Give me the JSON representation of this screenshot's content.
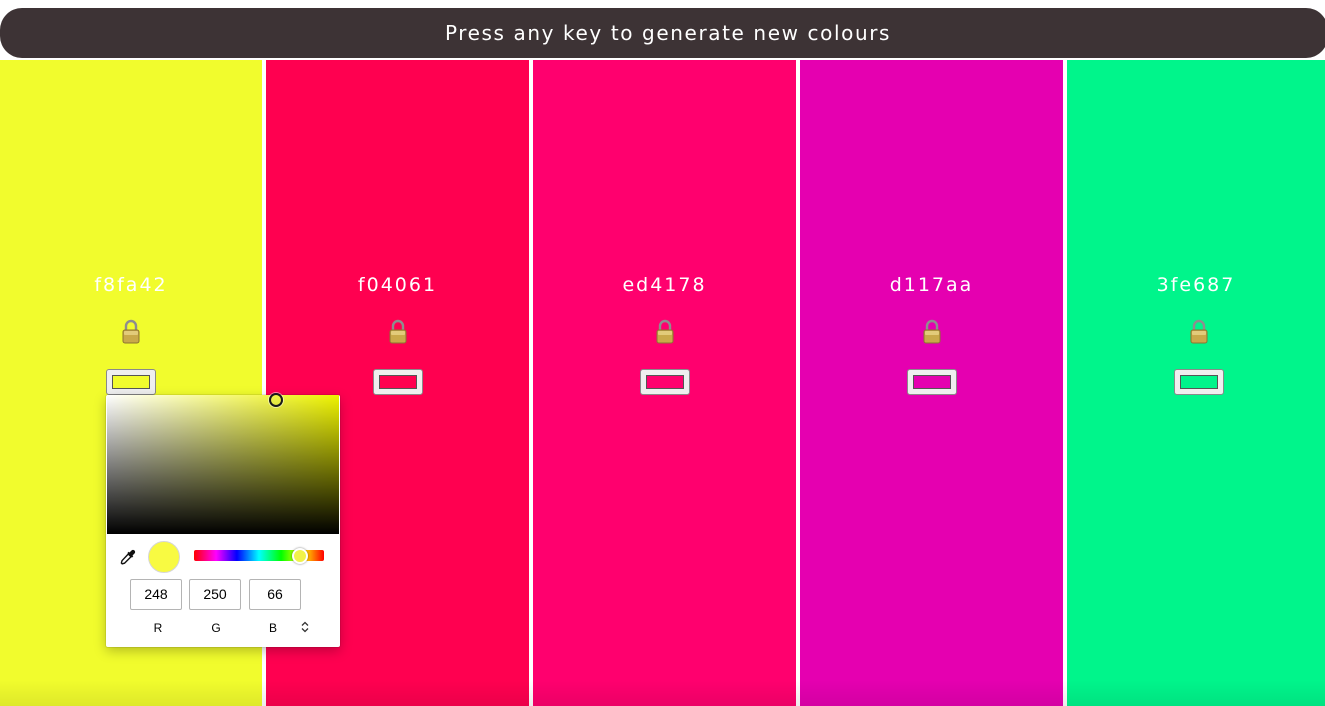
{
  "header": {
    "text": "Press any key to generate new colours",
    "background": "#3d3335"
  },
  "swatches": [
    {
      "hex": "f8fa42",
      "color": "#f1fc2d"
    },
    {
      "hex": "f04061",
      "color": "#ff0050"
    },
    {
      "hex": "ed4178",
      "color": "#ff006e"
    },
    {
      "hex": "d117aa",
      "color": "#e500b0"
    },
    {
      "hex": "3fe687",
      "color": "#00f58b"
    }
  ],
  "picker": {
    "selected_color": "#f8fa42",
    "r": "248",
    "g": "250",
    "b": "66",
    "labels": {
      "r": "R",
      "g": "G",
      "b": "B"
    },
    "icons": [
      "eyedropper-icon",
      "mode-toggle-icon"
    ]
  }
}
